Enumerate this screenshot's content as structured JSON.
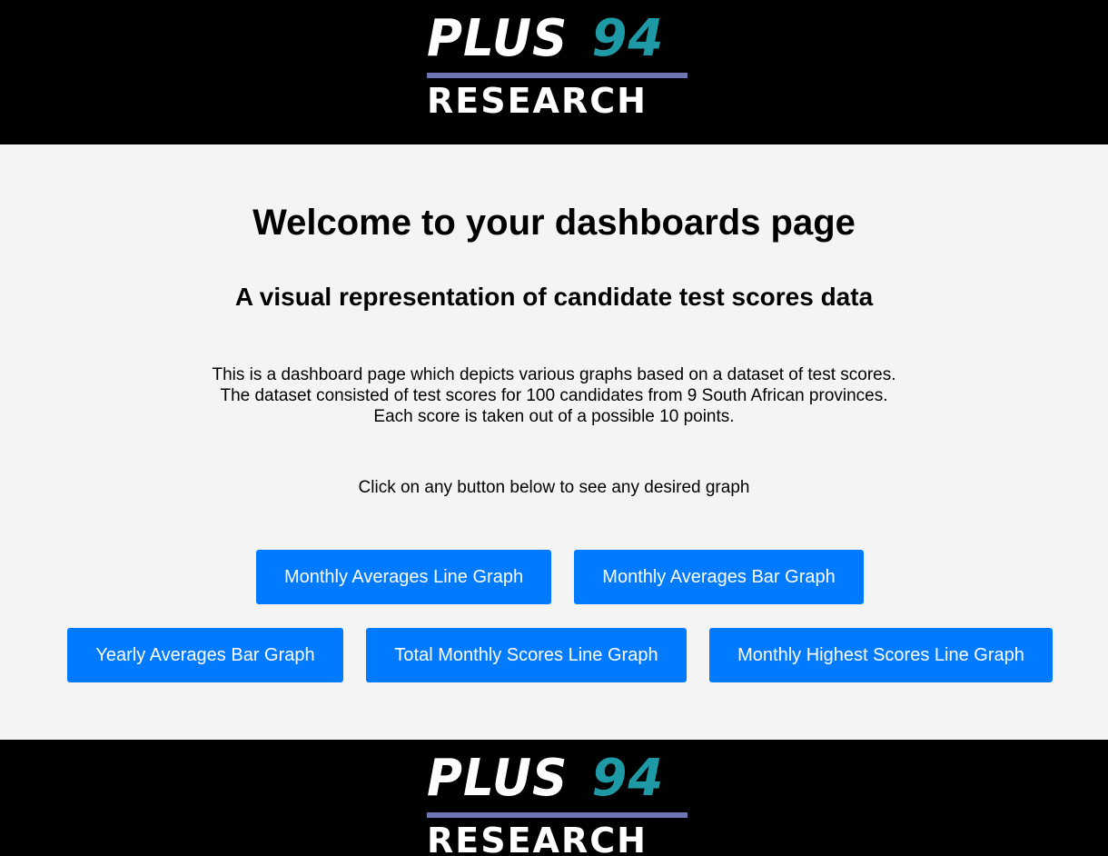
{
  "logo": {
    "line1_word": "PLUS",
    "line1_number": "94",
    "line2": "RESEARCH",
    "colors": {
      "white": "#ffffff",
      "teal": "#1e9aa6",
      "rule": "#6f74b3"
    }
  },
  "main": {
    "title": "Welcome to your dashboards page",
    "subtitle": "A visual representation of candidate test scores data",
    "description": [
      "This is a dashboard page which depicts various graphs based on a dataset of test scores.",
      "The dataset consisted of test scores for 100 candidates from 9 South African provinces.",
      "Each score is taken out of a possible 10 points."
    ],
    "prompt": "Click on any button below to see any desired graph",
    "buttons": [
      "Monthly Averages Line Graph",
      "Monthly Averages Bar Graph",
      "Yearly Averages Bar Graph",
      "Total Monthly Scores Line Graph",
      "Monthly Highest Scores Line Graph"
    ]
  },
  "colors": {
    "header_bg": "#000000",
    "page_bg": "#f4f4f4",
    "button_bg": "#007bff",
    "button_text": "#ffffff"
  }
}
